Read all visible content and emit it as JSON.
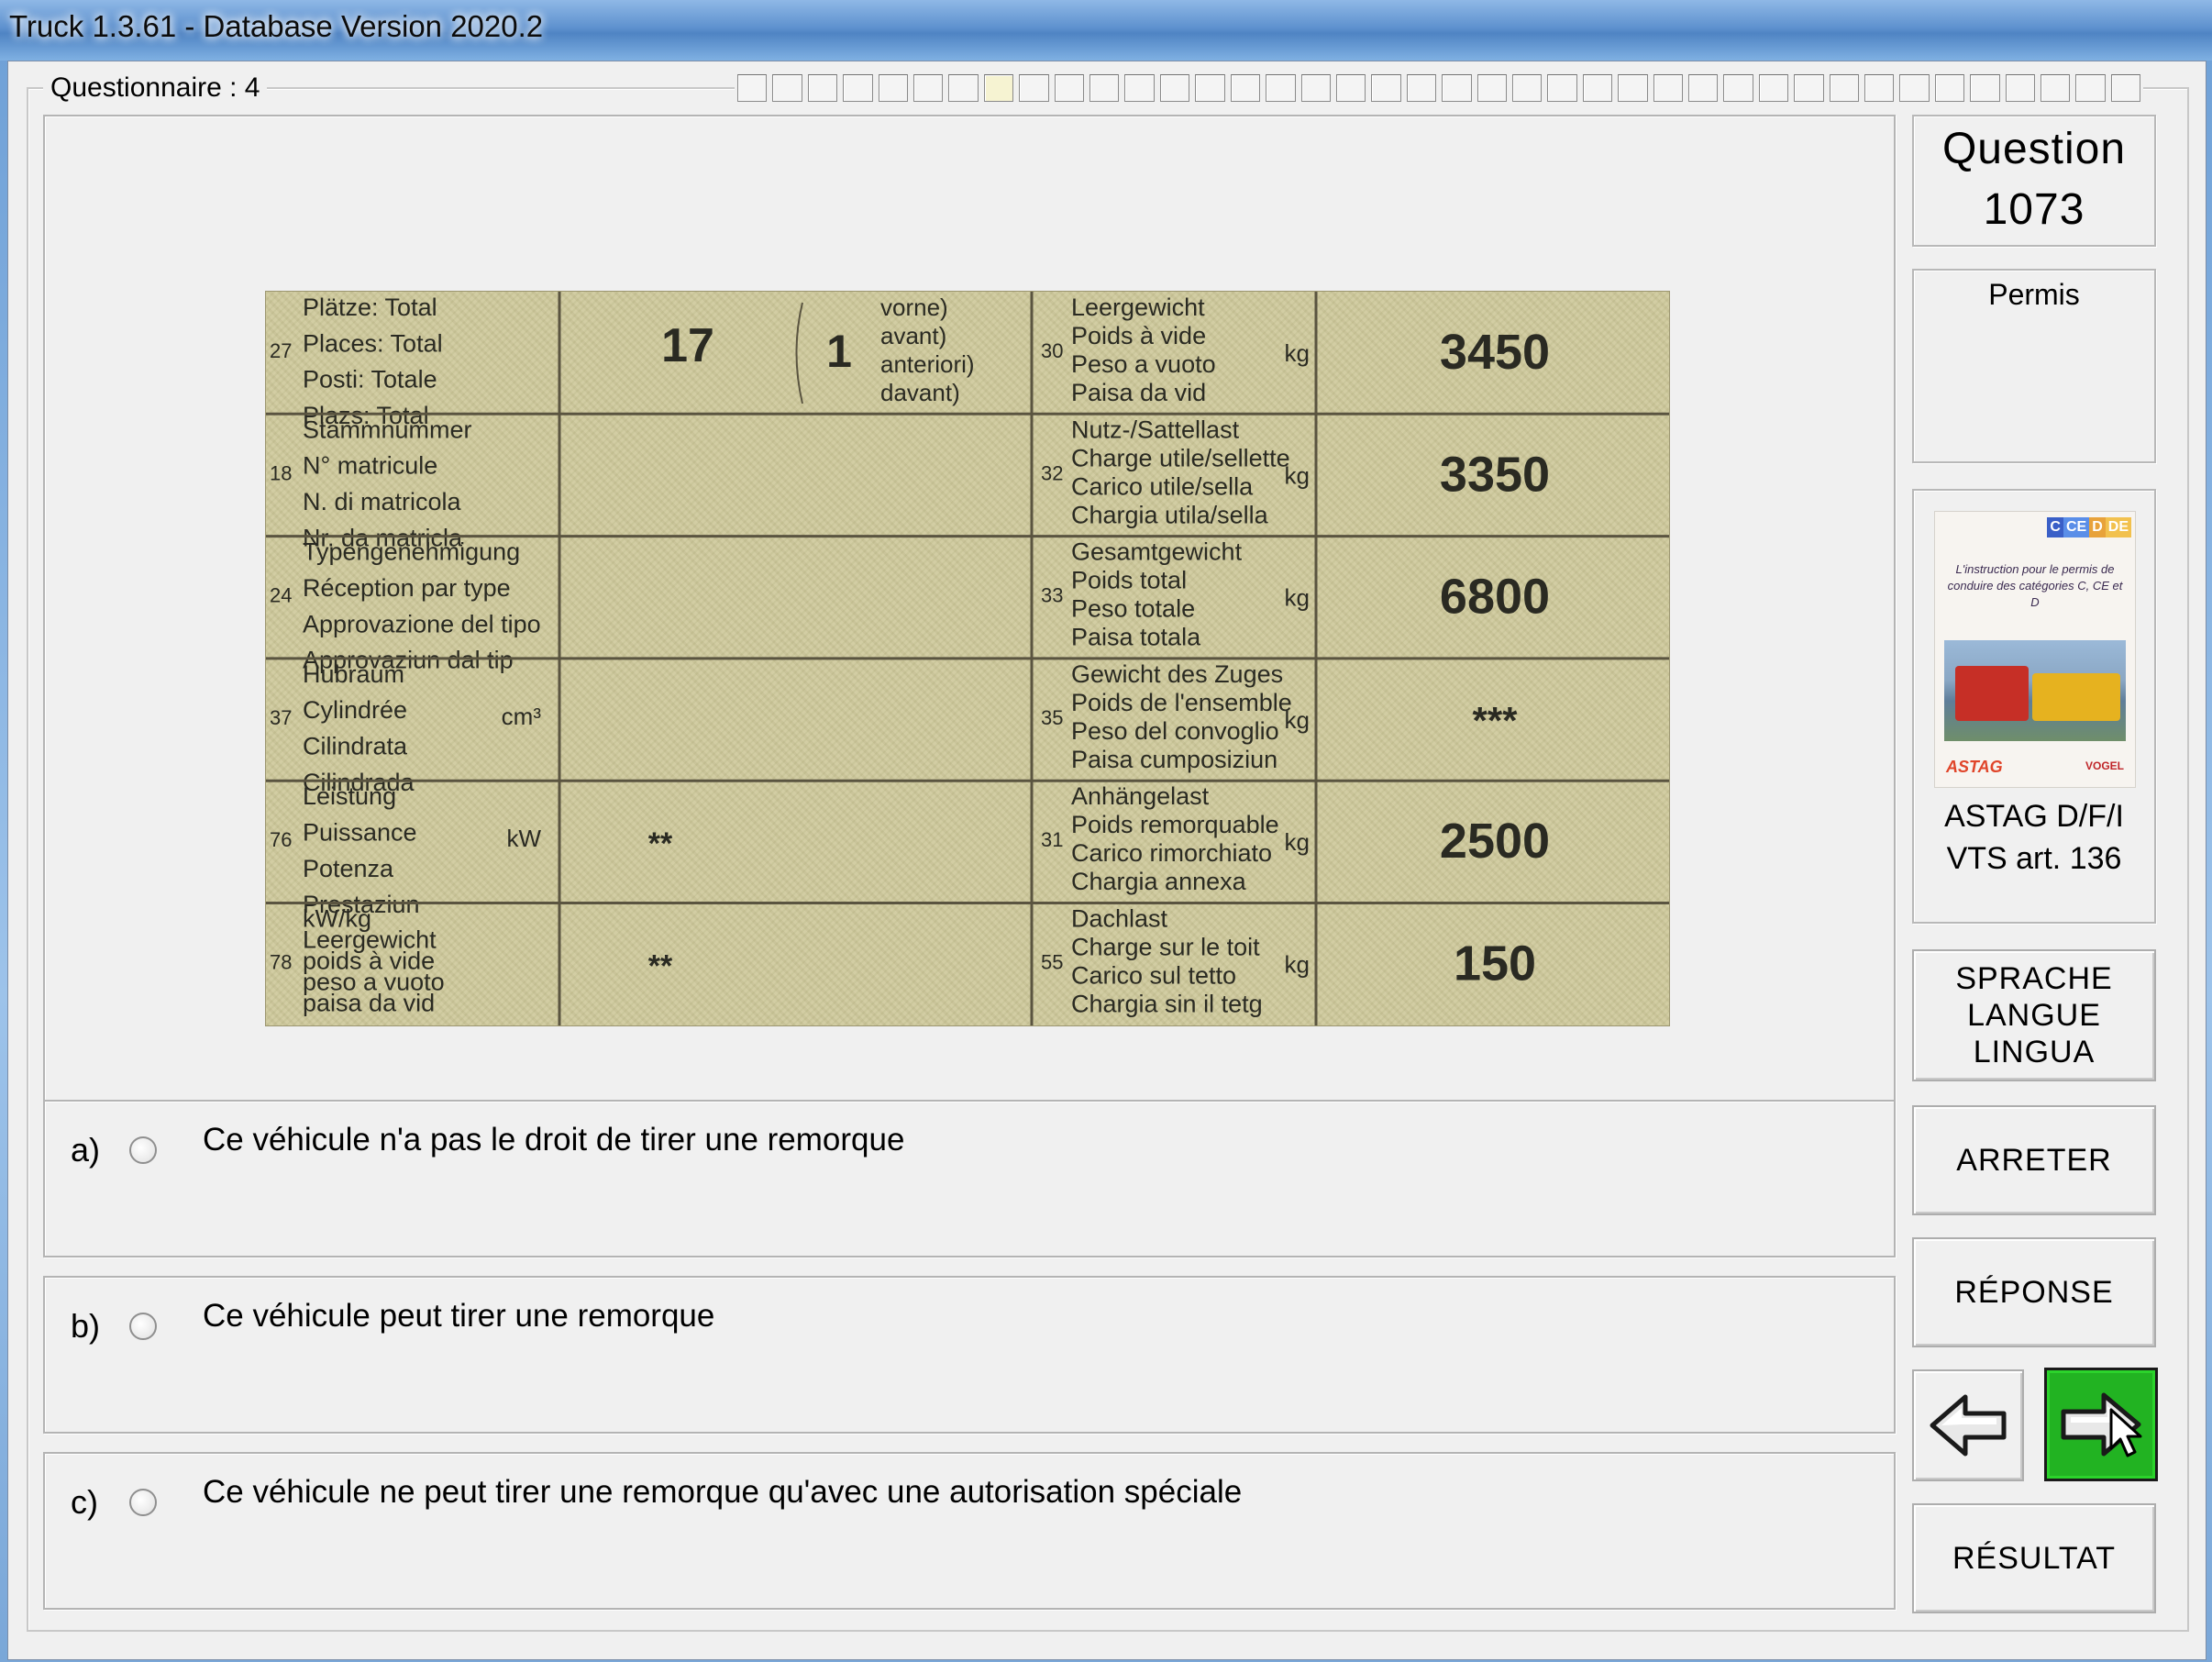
{
  "window": {
    "title": "Truck 1.3.61 - Database Version 2020.2"
  },
  "questionnaire": {
    "label": "Questionnaire : 4"
  },
  "progress": {
    "total": 40,
    "current_index": 7
  },
  "question": {
    "title_line1": "Question",
    "title_line2": "1073",
    "category": "Permis"
  },
  "book": {
    "badges": [
      "C",
      "CE",
      "D",
      "DE"
    ],
    "cover_text": "L'instruction pour le permis de conduire des catégories C, CE et D",
    "logo_left": "ASTAG",
    "logo_right": "VOGEL",
    "source_line1": "ASTAG D/F/I",
    "source_line2": "VTS art. 136"
  },
  "document": {
    "rows": [
      {
        "num": "27",
        "labels": [
          "Plätze: Total",
          "Places: Total",
          "Posti: Totale",
          "Plazs: Total"
        ],
        "value": "17",
        "extra_num": "1",
        "extra_labels": [
          "vorne)",
          "avant)",
          "anteriori)",
          "davant)"
        ],
        "r_num": "30",
        "r_labels": [
          "Leergewicht",
          "Poids à vide",
          "Peso a vuoto",
          "Paisa da vid"
        ],
        "r_unit": "kg",
        "r_value": "3450"
      },
      {
        "num": "18",
        "labels": [
          "Stammnummer",
          "N° matricule",
          "N. di matricola",
          "Nr. da matricla"
        ],
        "value": "",
        "r_num": "32",
        "r_labels": [
          "Nutz-/Sattellast",
          "Charge utile/sellette",
          "Carico utile/sella",
          "Chargia utila/sella"
        ],
        "r_unit": "kg",
        "r_value": "3350"
      },
      {
        "num": "24",
        "labels": [
          "Typengenehmigung",
          "Réception par type",
          "Approvazione del tipo",
          "Approvaziun dal tip"
        ],
        "value": "",
        "r_num": "33",
        "r_labels": [
          "Gesamtgewicht",
          "Poids total",
          "Peso totale",
          "Paisa totala"
        ],
        "r_unit": "kg",
        "r_value": "6800"
      },
      {
        "num": "37",
        "labels": [
          "Hubraum",
          "Cylindrée",
          "Cilindrata",
          "Cilindrada"
        ],
        "unit": "cm³",
        "value": "",
        "r_num": "35",
        "r_labels": [
          "Gewicht des Zuges",
          "Poids de l'ensemble",
          "Peso del convoglio",
          "Paisa cumposiziun"
        ],
        "r_unit": "kg",
        "r_value": "***"
      },
      {
        "num": "76",
        "labels": [
          "Leistung",
          "Puissance",
          "Potenza",
          "Prestaziun"
        ],
        "unit": "kW",
        "value": "**",
        "r_num": "31",
        "r_labels": [
          "Anhängelast",
          "Poids remorquable",
          "Carico rimorchiato",
          "Chargia annexa"
        ],
        "r_unit": "kg",
        "r_value": "2500"
      },
      {
        "num": "78",
        "labels": [
          "kW/kg",
          "Leergewicht",
          "poids à vide",
          "peso a vuoto",
          "paisa da vid"
        ],
        "value": "**",
        "r_num": "55",
        "r_labels": [
          "Dachlast",
          "Charge sur le toit",
          "Carico sul tetto",
          "Chargia sin il tetg"
        ],
        "r_unit": "kg",
        "r_value": "150"
      }
    ]
  },
  "answers": [
    {
      "letter": "a)",
      "text": "Ce véhicule n'a pas le droit de tirer une remorque"
    },
    {
      "letter": "b)",
      "text": "Ce véhicule peut tirer une remorque"
    },
    {
      "letter": "c)",
      "text": "Ce véhicule ne peut tirer une remorque qu'avec une autorisation spéciale"
    }
  ],
  "buttons": {
    "language": [
      "SPRACHE",
      "LANGUE",
      "LINGUA"
    ],
    "stop": "ARRETER",
    "answer": "RÉPONSE",
    "result": "RÉSULTAT"
  },
  "colors": {
    "next_button": "#22b322",
    "badge_c": "#3a5fc7",
    "badge_ce": "#5a8ee8",
    "badge_d": "#e8a23a",
    "badge_de": "#f2c14e"
  },
  "icons": {
    "previous": "arrow-left-icon",
    "next": "arrow-right-icon"
  }
}
